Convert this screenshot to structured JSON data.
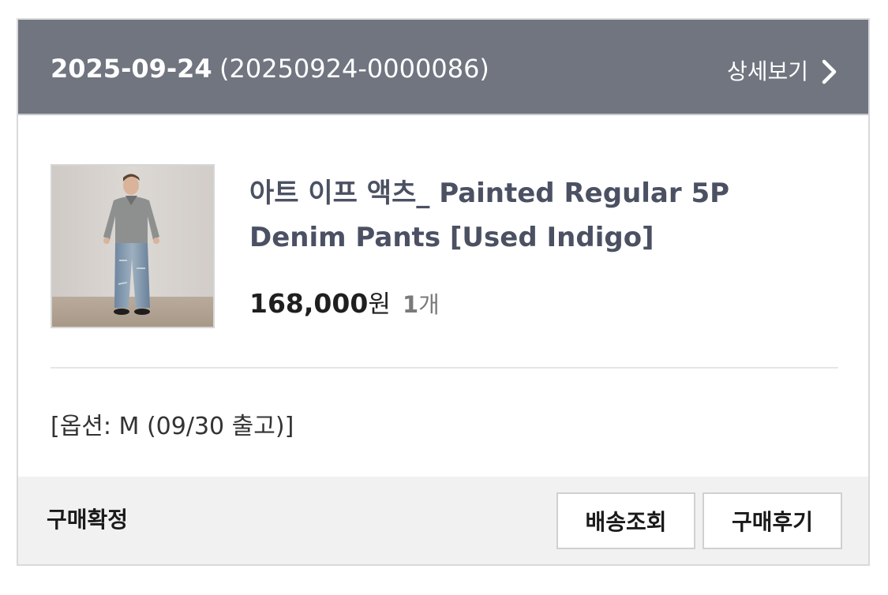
{
  "order": {
    "date": "2025-09-24",
    "number": "(20250924-0000086)",
    "detail_label": "상세보기",
    "detail_icon": "chevron-right-icon"
  },
  "product": {
    "image_icon": "product-photo",
    "name": "아트 이프 액츠_ Painted Regular 5P Denim Pants [Used Indigo]",
    "price": "168,000",
    "currency": "원",
    "quantity": "1",
    "quantity_unit": "개",
    "option": "[옵션: M (09/30 출고)]"
  },
  "footer": {
    "status": "구매확정",
    "track_button": "배송조회",
    "review_button": "구매후기"
  },
  "colors": {
    "header_bg": "#707580",
    "product_name": "#4b5163",
    "footer_bg": "#f1f1f1"
  }
}
